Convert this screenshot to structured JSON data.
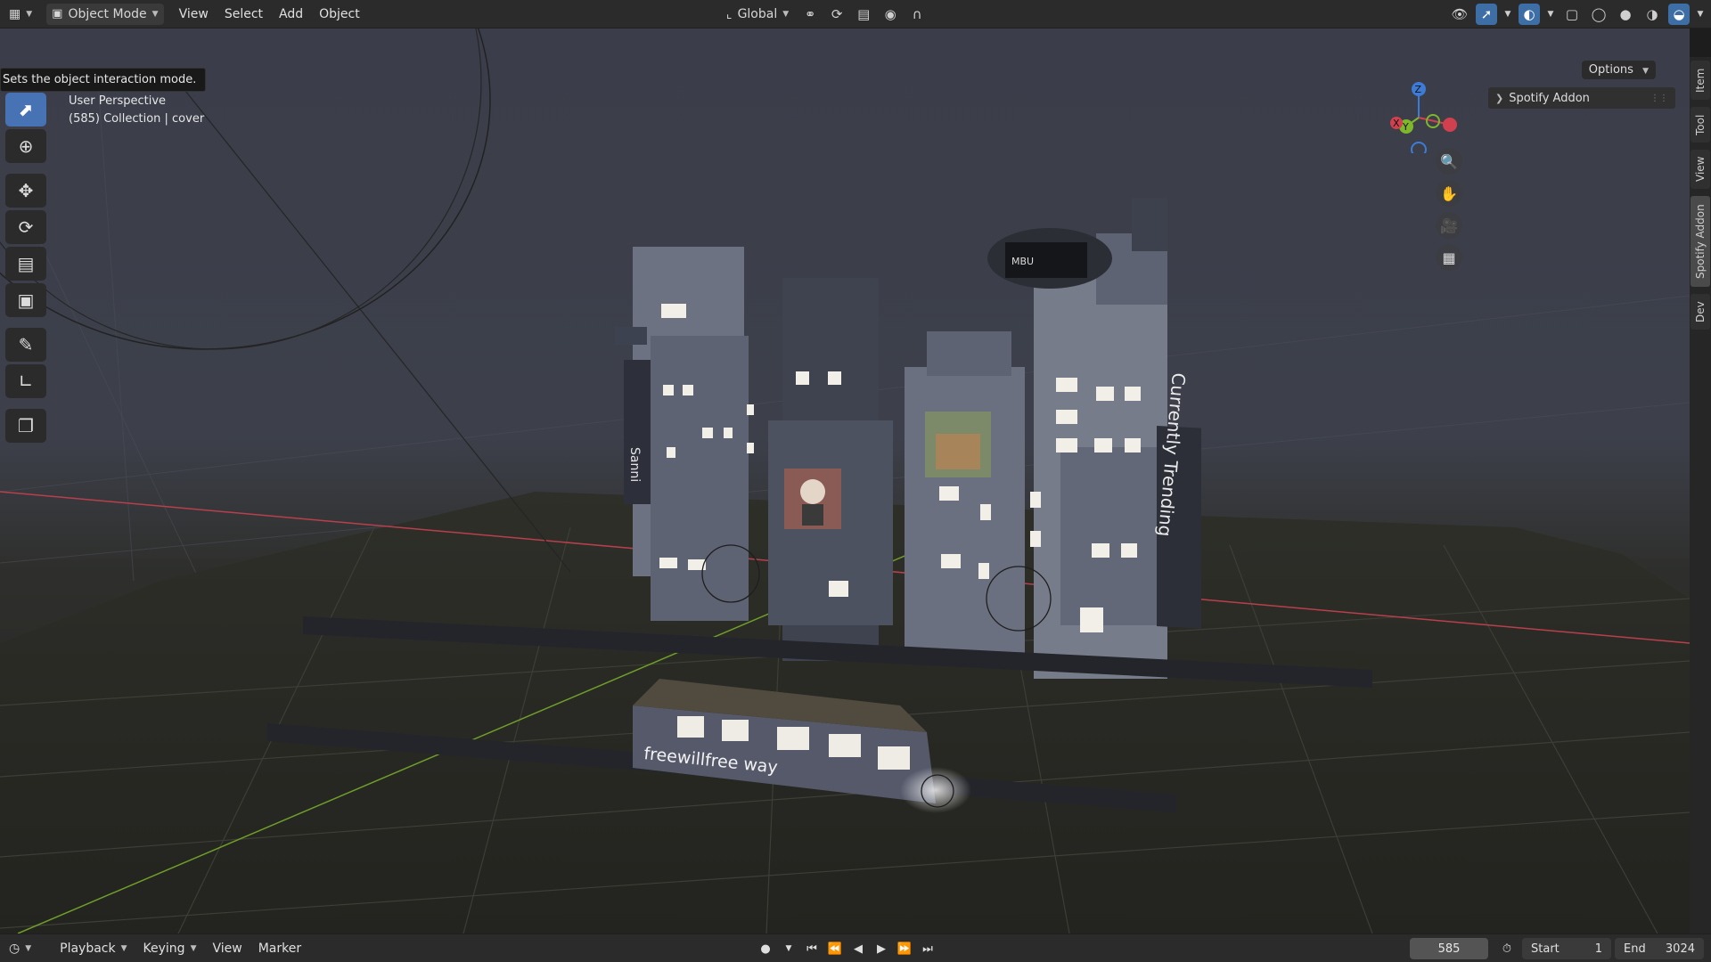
{
  "header": {
    "editor_type_icon": "3d-viewport-icon",
    "mode_label": "Object Mode",
    "menus": [
      "View",
      "Select",
      "Add",
      "Object"
    ],
    "transform_orientation": "Global"
  },
  "tooltip": {
    "text": "Sets the object interaction mode."
  },
  "viewport": {
    "perspective_label": "User Perspective",
    "collection_label": "(585) Collection | cover",
    "options_label": "Options"
  },
  "gizmo": {
    "z": "Z",
    "y": "Y",
    "x": "X"
  },
  "scene_text": {
    "banner": "Currently Trending",
    "train": "freewillfree way",
    "blimp": "MBU",
    "sign_left": "Sanni"
  },
  "sidebar": {
    "panel_title": "Spotify Addon",
    "tabs": [
      "Item",
      "Tool",
      "View",
      "Spotify Addon",
      "Dev"
    ]
  },
  "timeline": {
    "menus": [
      "Playback",
      "Keying",
      "View",
      "Marker"
    ],
    "current_frame": "585",
    "start_label": "Start",
    "start_value": "1",
    "end_label": "End",
    "end_value": "3024"
  },
  "colors": {
    "accent": "#4772b3",
    "axis_x": "#d1404e",
    "axis_y": "#7fb62b",
    "axis_z": "#3d7cd6"
  }
}
